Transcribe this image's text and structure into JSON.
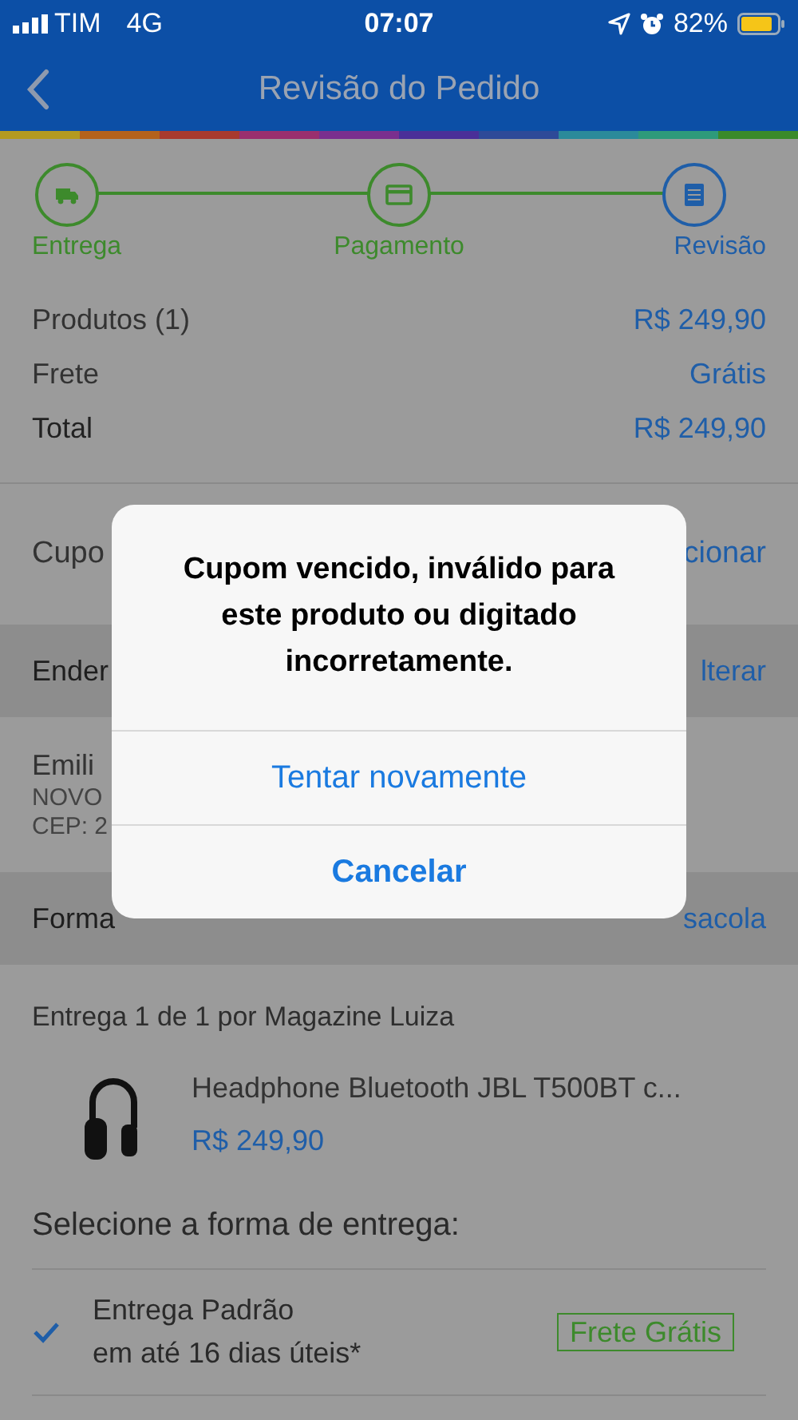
{
  "status_bar": {
    "carrier": "TIM",
    "network": "4G",
    "time": "07:07",
    "battery": "82%"
  },
  "nav": {
    "title": "Revisão do Pedido"
  },
  "steps": [
    {
      "label": "Entrega",
      "kind": "truck",
      "selected": false
    },
    {
      "label": "Pagamento",
      "kind": "card",
      "selected": false
    },
    {
      "label": "Revisão",
      "kind": "list",
      "selected": true
    }
  ],
  "summary": [
    {
      "label": "Produtos (1)",
      "value": "R$ 249,90",
      "kind": "line"
    },
    {
      "label": "Frete",
      "value": "Grátis",
      "kind": "line"
    },
    {
      "label": "Total",
      "value": "R$ 249,90",
      "kind": "total"
    }
  ],
  "coupon": {
    "label": "Cupo",
    "action": "cionar"
  },
  "address_header": {
    "label": "Ender",
    "action": "lterar"
  },
  "address_lines": [
    "Emili",
    "NOVO",
    "CEP: 2"
  ],
  "delivery_header": {
    "label": "Forma",
    "action": "sacola"
  },
  "shipment": {
    "title": "Entrega 1 de 1 por Magazine Luiza",
    "product": "Headphone Bluetooth JBL T500BT c...",
    "price": "R$ 249,90"
  },
  "delivery_prompt": "Selecione a forma de entrega:",
  "delivery_options": [
    {
      "name": "Entrega Padrão",
      "eta": "em até 16 dias úteis*",
      "badge": "Frete Grátis",
      "selected": true
    }
  ],
  "dialog": {
    "message": "Cupom vencido, inválido para este produto ou digitado incorretamente.",
    "buttons": [
      {
        "label": "Tentar novamente",
        "kind": "default"
      },
      {
        "label": "Cancelar",
        "kind": "cancel"
      }
    ]
  }
}
